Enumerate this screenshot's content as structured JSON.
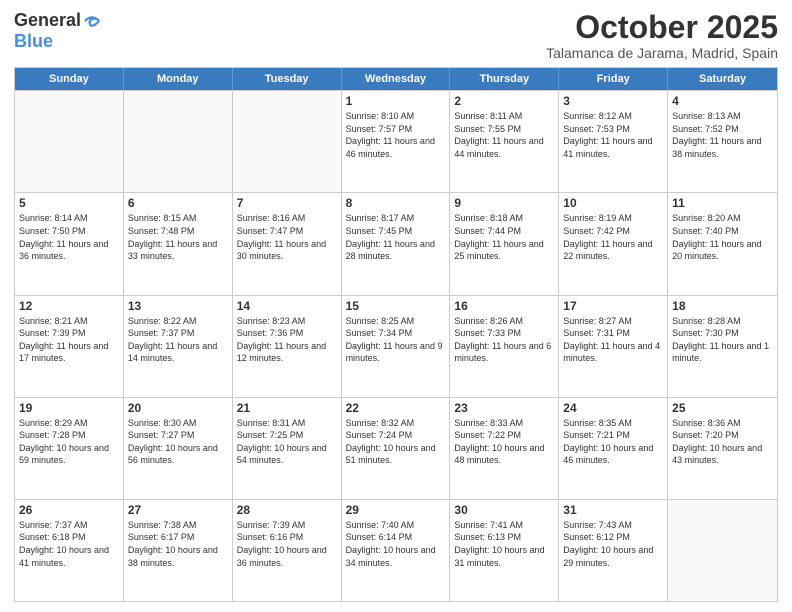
{
  "logo": {
    "general": "General",
    "blue": "Blue"
  },
  "title": "October 2025",
  "location": "Talamanca de Jarama, Madrid, Spain",
  "headers": [
    "Sunday",
    "Monday",
    "Tuesday",
    "Wednesday",
    "Thursday",
    "Friday",
    "Saturday"
  ],
  "weeks": [
    [
      {
        "day": "",
        "info": ""
      },
      {
        "day": "",
        "info": ""
      },
      {
        "day": "",
        "info": ""
      },
      {
        "day": "1",
        "info": "Sunrise: 8:10 AM\nSunset: 7:57 PM\nDaylight: 11 hours and 46 minutes."
      },
      {
        "day": "2",
        "info": "Sunrise: 8:11 AM\nSunset: 7:55 PM\nDaylight: 11 hours and 44 minutes."
      },
      {
        "day": "3",
        "info": "Sunrise: 8:12 AM\nSunset: 7:53 PM\nDaylight: 11 hours and 41 minutes."
      },
      {
        "day": "4",
        "info": "Sunrise: 8:13 AM\nSunset: 7:52 PM\nDaylight: 11 hours and 38 minutes."
      }
    ],
    [
      {
        "day": "5",
        "info": "Sunrise: 8:14 AM\nSunset: 7:50 PM\nDaylight: 11 hours and 36 minutes."
      },
      {
        "day": "6",
        "info": "Sunrise: 8:15 AM\nSunset: 7:48 PM\nDaylight: 11 hours and 33 minutes."
      },
      {
        "day": "7",
        "info": "Sunrise: 8:16 AM\nSunset: 7:47 PM\nDaylight: 11 hours and 30 minutes."
      },
      {
        "day": "8",
        "info": "Sunrise: 8:17 AM\nSunset: 7:45 PM\nDaylight: 11 hours and 28 minutes."
      },
      {
        "day": "9",
        "info": "Sunrise: 8:18 AM\nSunset: 7:44 PM\nDaylight: 11 hours and 25 minutes."
      },
      {
        "day": "10",
        "info": "Sunrise: 8:19 AM\nSunset: 7:42 PM\nDaylight: 11 hours and 22 minutes."
      },
      {
        "day": "11",
        "info": "Sunrise: 8:20 AM\nSunset: 7:40 PM\nDaylight: 11 hours and 20 minutes."
      }
    ],
    [
      {
        "day": "12",
        "info": "Sunrise: 8:21 AM\nSunset: 7:39 PM\nDaylight: 11 hours and 17 minutes."
      },
      {
        "day": "13",
        "info": "Sunrise: 8:22 AM\nSunset: 7:37 PM\nDaylight: 11 hours and 14 minutes."
      },
      {
        "day": "14",
        "info": "Sunrise: 8:23 AM\nSunset: 7:36 PM\nDaylight: 11 hours and 12 minutes."
      },
      {
        "day": "15",
        "info": "Sunrise: 8:25 AM\nSunset: 7:34 PM\nDaylight: 11 hours and 9 minutes."
      },
      {
        "day": "16",
        "info": "Sunrise: 8:26 AM\nSunset: 7:33 PM\nDaylight: 11 hours and 6 minutes."
      },
      {
        "day": "17",
        "info": "Sunrise: 8:27 AM\nSunset: 7:31 PM\nDaylight: 11 hours and 4 minutes."
      },
      {
        "day": "18",
        "info": "Sunrise: 8:28 AM\nSunset: 7:30 PM\nDaylight: 11 hours and 1 minute."
      }
    ],
    [
      {
        "day": "19",
        "info": "Sunrise: 8:29 AM\nSunset: 7:28 PM\nDaylight: 10 hours and 59 minutes."
      },
      {
        "day": "20",
        "info": "Sunrise: 8:30 AM\nSunset: 7:27 PM\nDaylight: 10 hours and 56 minutes."
      },
      {
        "day": "21",
        "info": "Sunrise: 8:31 AM\nSunset: 7:25 PM\nDaylight: 10 hours and 54 minutes."
      },
      {
        "day": "22",
        "info": "Sunrise: 8:32 AM\nSunset: 7:24 PM\nDaylight: 10 hours and 51 minutes."
      },
      {
        "day": "23",
        "info": "Sunrise: 8:33 AM\nSunset: 7:22 PM\nDaylight: 10 hours and 48 minutes."
      },
      {
        "day": "24",
        "info": "Sunrise: 8:35 AM\nSunset: 7:21 PM\nDaylight: 10 hours and 46 minutes."
      },
      {
        "day": "25",
        "info": "Sunrise: 8:36 AM\nSunset: 7:20 PM\nDaylight: 10 hours and 43 minutes."
      }
    ],
    [
      {
        "day": "26",
        "info": "Sunrise: 7:37 AM\nSunset: 6:18 PM\nDaylight: 10 hours and 41 minutes."
      },
      {
        "day": "27",
        "info": "Sunrise: 7:38 AM\nSunset: 6:17 PM\nDaylight: 10 hours and 38 minutes."
      },
      {
        "day": "28",
        "info": "Sunrise: 7:39 AM\nSunset: 6:16 PM\nDaylight: 10 hours and 36 minutes."
      },
      {
        "day": "29",
        "info": "Sunrise: 7:40 AM\nSunset: 6:14 PM\nDaylight: 10 hours and 34 minutes."
      },
      {
        "day": "30",
        "info": "Sunrise: 7:41 AM\nSunset: 6:13 PM\nDaylight: 10 hours and 31 minutes."
      },
      {
        "day": "31",
        "info": "Sunrise: 7:43 AM\nSunset: 6:12 PM\nDaylight: 10 hours and 29 minutes."
      },
      {
        "day": "",
        "info": ""
      }
    ]
  ]
}
